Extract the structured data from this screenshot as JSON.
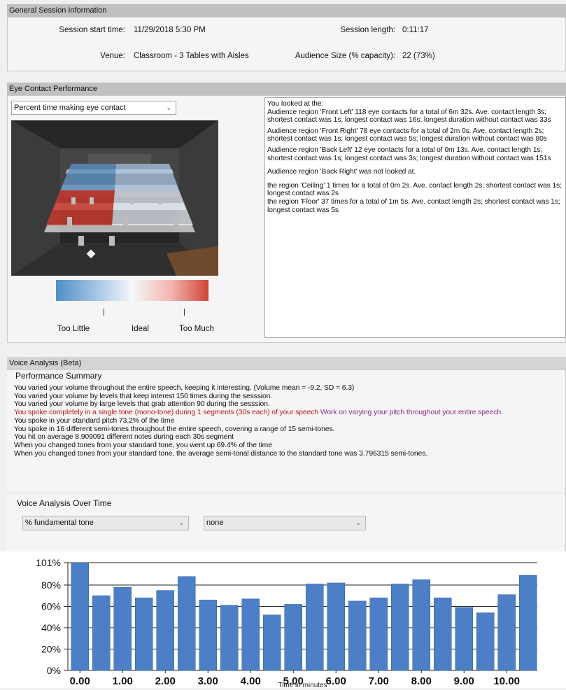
{
  "general": {
    "header": "General Session Information",
    "start_label": "Session start time:",
    "start_value": "11/29/2018 5:30 PM",
    "length_label": "Session length:",
    "length_value": "0:11:17",
    "venue_label": "Venue:",
    "venue_value": "Classroom - 3 Tables with Aisles",
    "audience_label": "Audience Size (% capacity):",
    "audience_value": "22 (73%)"
  },
  "eye": {
    "header": "Eye Contact Performance",
    "dropdown_value": "Percent time making eye contact",
    "details": [
      "You looked at the:\nAudience region 'Front Left' 118 eye contacts for a total of 6m 32s. Ave. contact length 3s; shortest contact was 1s; longest contact was 16s; longest duration without contact was 33s",
      "Audience region 'Front Right' 78 eye contacts for a total of 2m 0s. Ave. contact length 2s; shortest contact was 1s; longest contact was 5s; longest duration without contact was 80s",
      "Audience region 'Back Left' 12 eye contacts for a total of 0m 13s. Ave. contact length 1s; shortest contact was 1s; longest contact was 3s; longest duration without contact was 151s",
      "Audience region 'Back Right' was not looked at.",
      "the region 'Ceiling' 1 times for a total of 0m 2s. Ave. contact length 2s; shortest contact was 1s; longest contact was 2s\nthe region 'Floor' 37 times for a total of 1m 5s. Ave. contact length 2s; shortest contact was 1s; longest contact was 5s"
    ],
    "legend": {
      "low": "Too Little",
      "mid": "Ideal",
      "high": "Too Much"
    },
    "colors": {
      "low": "#4f8fc4",
      "high": "#cf4536"
    }
  },
  "voice": {
    "header": "Voice Analysis (Beta)",
    "summary_title": "Performance Summary",
    "lines": [
      {
        "text": "You varied your volume throughout the entire speech, keeping it interesting. (Volume mean = -9.2, SD = 6.3)",
        "style": ""
      },
      {
        "text": "You varied your volume by levels that keep interest 150 times during the sesssion.",
        "style": ""
      },
      {
        "text": "You varied your volume by large levels that grab attention 90 during the sesssion.",
        "style": ""
      },
      {
        "text": "You spoke completely in a single tone (mono-tone) during 1 segments (30s each) of your speech",
        "tip": " Work on varying your pitch throughout your entire speech.",
        "style": "red"
      },
      {
        "text": "You spoke in your standard pitch 73.2% of the time",
        "style": ""
      },
      {
        "text": "You spoke in 16 different semi-tones throughout the entire speech, covering a range of 15 semi-tones.",
        "style": ""
      },
      {
        "text": "You hit on average 8.909091 different notes during each 30s segment",
        "style": ""
      },
      {
        "text": "When you changed tones from your standard tone, you went up 69.4% of the time",
        "style": ""
      },
      {
        "text": "When you changed tones from your standard tone, the average semi-tonal distance to the standard tone was 3.796315 semi-tones.",
        "style": ""
      }
    ],
    "over_time_title": "Voice Analysis Over Time",
    "select1": "% fundamental tone",
    "select2": "none"
  },
  "chart_data": {
    "type": "bar",
    "xlabel": "Time in minutes",
    "ylabel": "",
    "ylim": [
      0,
      101
    ],
    "yticks": [
      "0%",
      "20%",
      "40%",
      "60%",
      "80%",
      "101%"
    ],
    "ytick_values": [
      0,
      20,
      40,
      60,
      80,
      101
    ],
    "xticks": [
      "0.00",
      "1.00",
      "2.00",
      "3.00",
      "4.00",
      "5.00",
      "6.00",
      "7.00",
      "8.00",
      "9.00",
      "10.00"
    ],
    "values": [
      101,
      70,
      78,
      68,
      75,
      88,
      66,
      61,
      67,
      52,
      62,
      81,
      82,
      65,
      68,
      81,
      85,
      68,
      59,
      54,
      71,
      89
    ],
    "bar_color": "#4d7fc6",
    "grid": true
  }
}
